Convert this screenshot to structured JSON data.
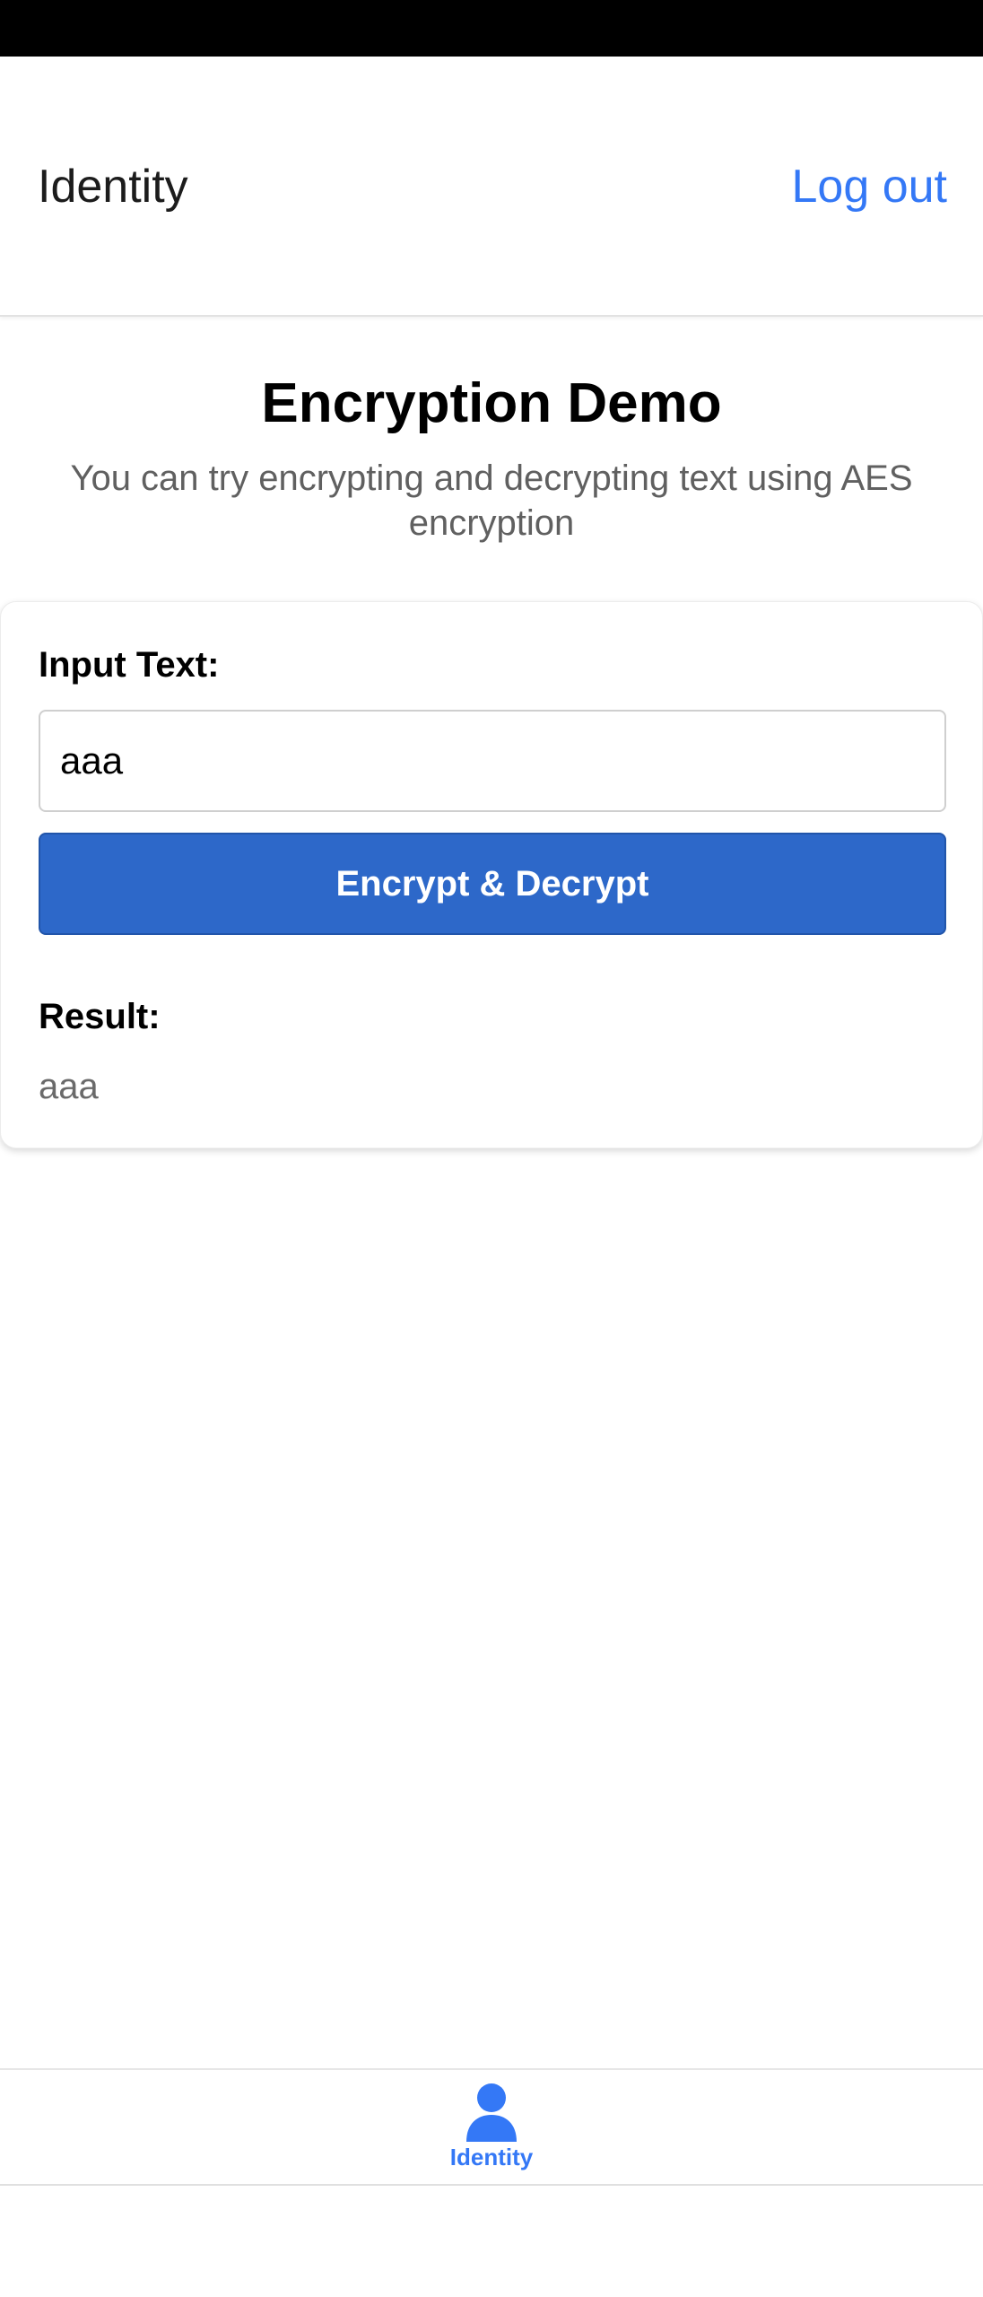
{
  "header": {
    "title": "Identity",
    "logout_label": "Log out"
  },
  "intro": {
    "title": "Encryption Demo",
    "description": "You can try encrypting and decrypting text using AES encryption"
  },
  "form": {
    "input_label": "Input Text:",
    "input_value": "aaa",
    "button_label": "Encrypt & Decrypt",
    "result_label": "Result:",
    "result_value": "aaa"
  },
  "tab_bar": {
    "tabs": [
      {
        "label": "Identity",
        "icon": "person-icon",
        "active": true
      }
    ]
  },
  "colors": {
    "accent": "#3478f6",
    "button": "#2d68c9",
    "status_bar": "#000000"
  }
}
